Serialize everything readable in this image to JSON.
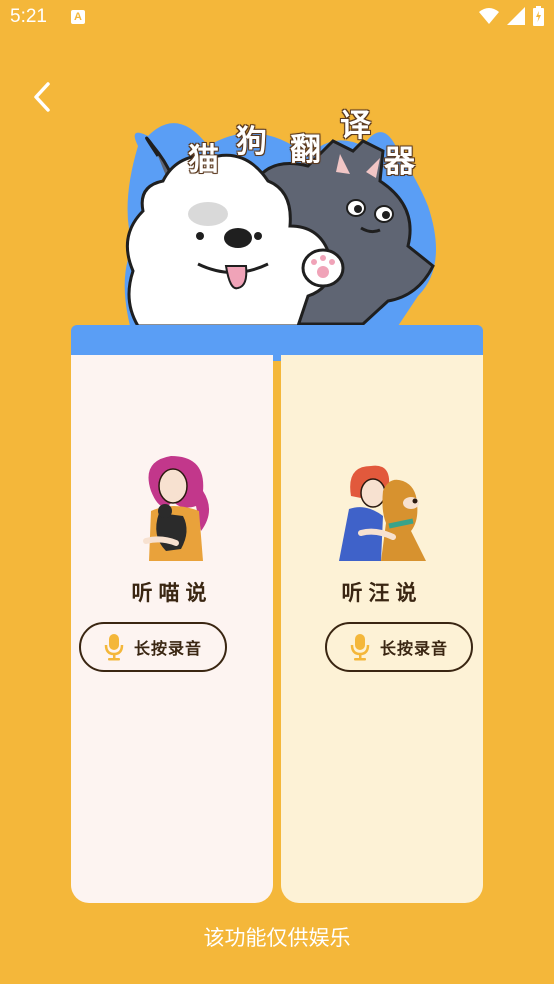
{
  "status_bar": {
    "time": "5:21",
    "notification_letter": "A"
  },
  "header": {
    "title_chars": [
      "猫",
      "狗",
      "翻",
      "译",
      "器"
    ]
  },
  "cards": {
    "cat": {
      "title": "听喵说",
      "button_label": "长按录音"
    },
    "dog": {
      "title": "听汪说",
      "button_label": "长按录音"
    }
  },
  "footer": {
    "disclaimer": "该功能仅供娱乐"
  },
  "colors": {
    "background": "#F4B73A",
    "banner_blue": "#5A9EF5",
    "cat_card": "#FDF4F1",
    "dog_card": "#FDF2D6",
    "text_dark": "#3a2612",
    "mic_icon": "#F4B73A"
  }
}
